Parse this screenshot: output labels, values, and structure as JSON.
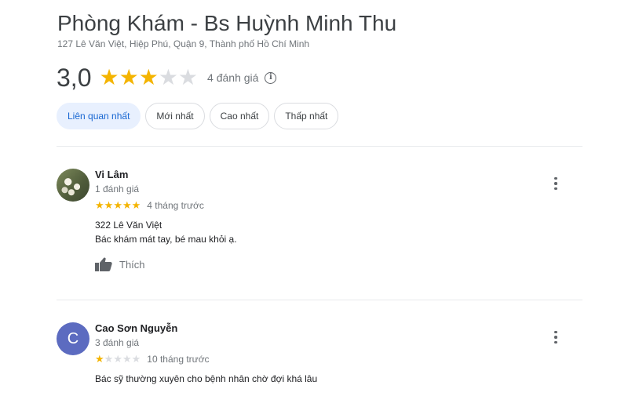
{
  "place": {
    "title": "Phòng Khám - Bs Huỳnh Minh Thu",
    "address": "127 Lê Văn Việt, Hiệp Phú, Quận 9, Thành phố Hồ Chí Minh"
  },
  "rating": {
    "value": "3,0",
    "stars_filled": 3,
    "stars_total": 5,
    "review_count": "4 đánh giá",
    "info_icon": "i"
  },
  "sort_chips": [
    {
      "label": "Liên quan nhất",
      "active": true
    },
    {
      "label": "Mới nhất",
      "active": false
    },
    {
      "label": "Cao nhất",
      "active": false
    },
    {
      "label": "Thấp nhất",
      "active": false
    }
  ],
  "reviews": [
    {
      "author": "Vi Lâm",
      "review_count": "1 đánh giá",
      "stars": 5,
      "time": "4 tháng trước",
      "lines": [
        "322 Lê Văn Việt",
        "Bác khám mát tay, bé mau khỏi ạ."
      ],
      "like_label": "Thích",
      "avatar": "photo"
    },
    {
      "author": "Cao Sơn Nguyễn",
      "review_count": "3 đánh giá",
      "stars": 1,
      "time": "10 tháng trước",
      "lines": [
        "Bác sỹ thường xuyên cho bệnh nhân chờ  đợi khá lâu"
      ],
      "avatar": "letter",
      "avatar_letter": "C"
    }
  ],
  "colors": {
    "star_filled": "#f4b400",
    "star_empty": "#dadce0",
    "chip_active_bg": "#e8f0fe",
    "chip_active_text": "#1967d2",
    "avatar_letter_bg": "#5c6bc0"
  },
  "icons": [
    "star-icon",
    "info-icon",
    "thumb-up-icon",
    "more-vert-icon"
  ]
}
